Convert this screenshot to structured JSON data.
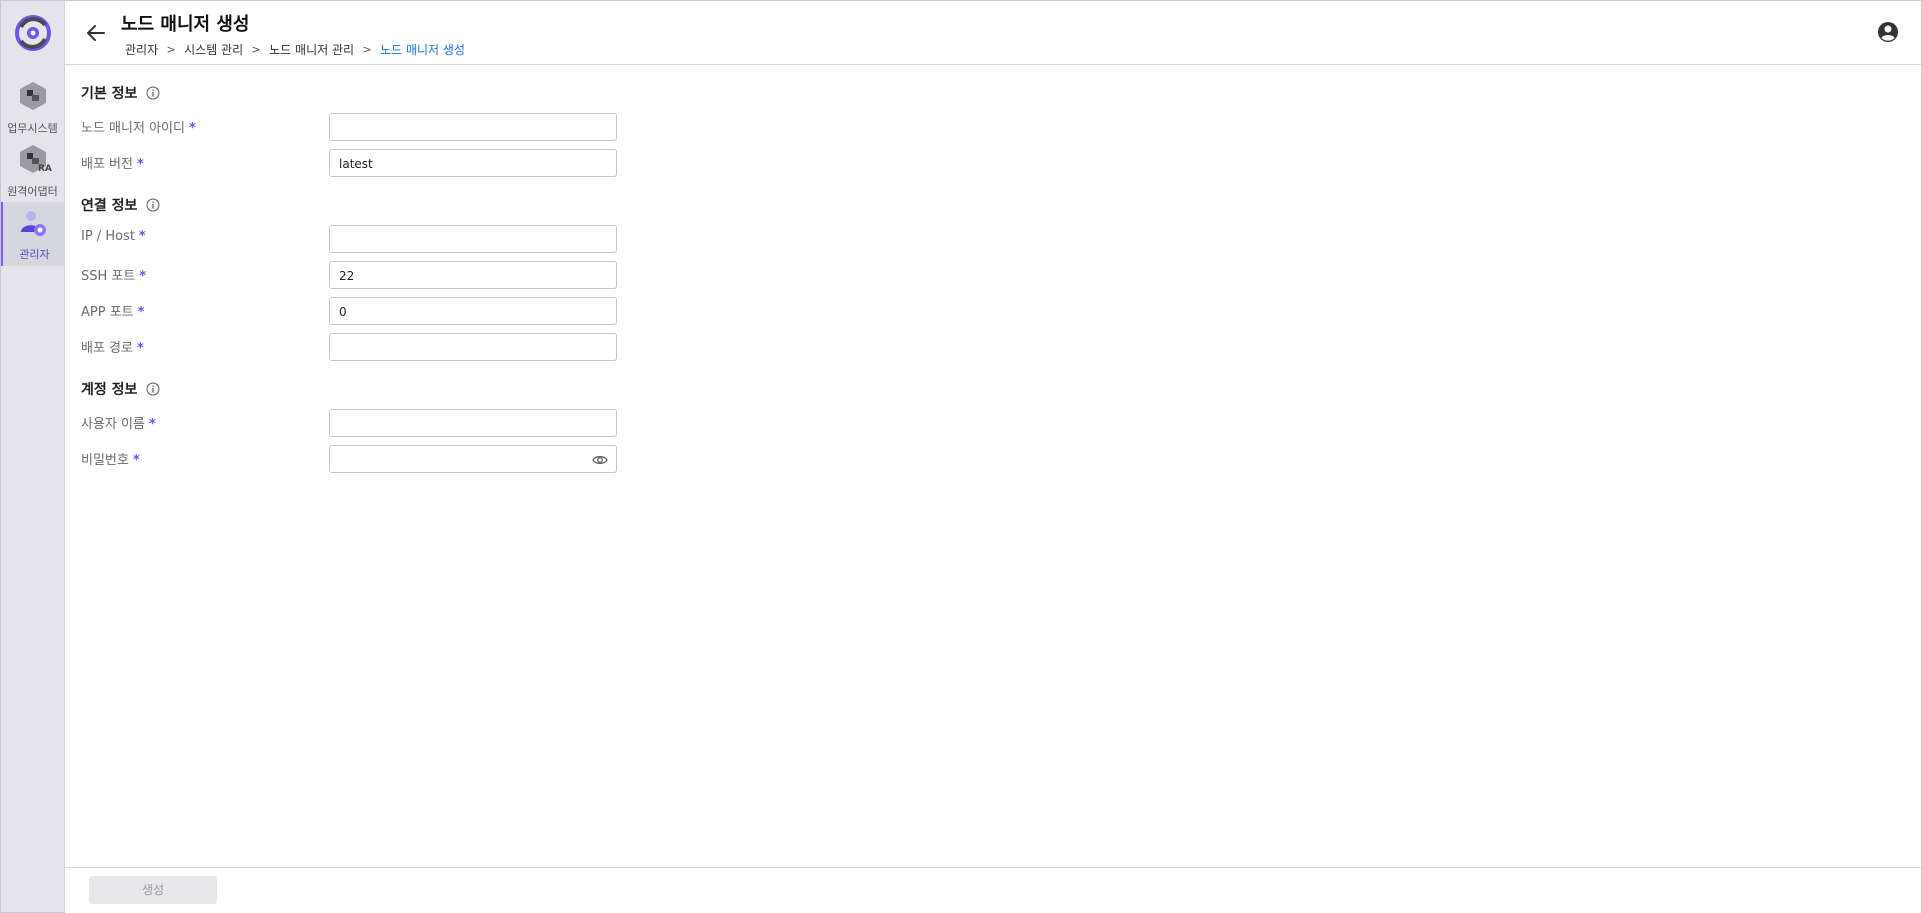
{
  "header": {
    "title": "노드 매니저 생성",
    "breadcrumb": [
      "관리자",
      "시스템 관리",
      "노드 매니저 관리",
      "노드 매니저 생성"
    ]
  },
  "sidebar": {
    "items": [
      {
        "label": "업무시스템",
        "icon": "business-system-icon",
        "active": false
      },
      {
        "label": "원격어댑터",
        "icon": "remote-adapter-icon",
        "badge": "RA",
        "active": false
      },
      {
        "label": "관리자",
        "icon": "admin-user-icon",
        "active": true
      }
    ]
  },
  "sections": {
    "basic": {
      "title": "기본 정보",
      "fields": [
        {
          "label": "노드 매니저 아이디",
          "value": ""
        },
        {
          "label": "배포 버전",
          "value": "latest"
        }
      ]
    },
    "connection": {
      "title": "연결 정보",
      "fields": [
        {
          "label": "IP / Host",
          "value": ""
        },
        {
          "label": "SSH 포트",
          "value": "22"
        },
        {
          "label": "APP 포트",
          "value": "0"
        },
        {
          "label": "배포 경로",
          "value": ""
        }
      ]
    },
    "account": {
      "title": "계정 정보",
      "fields": [
        {
          "label": "사용자 이름",
          "value": ""
        },
        {
          "label": "비밀번호",
          "value": ""
        }
      ]
    }
  },
  "required_mark": "*",
  "footer": {
    "create_label": "생성"
  },
  "colors": {
    "accent": "#6a52ff",
    "link": "#1a73e8",
    "sidebar_bg": "#e4e4ea"
  }
}
